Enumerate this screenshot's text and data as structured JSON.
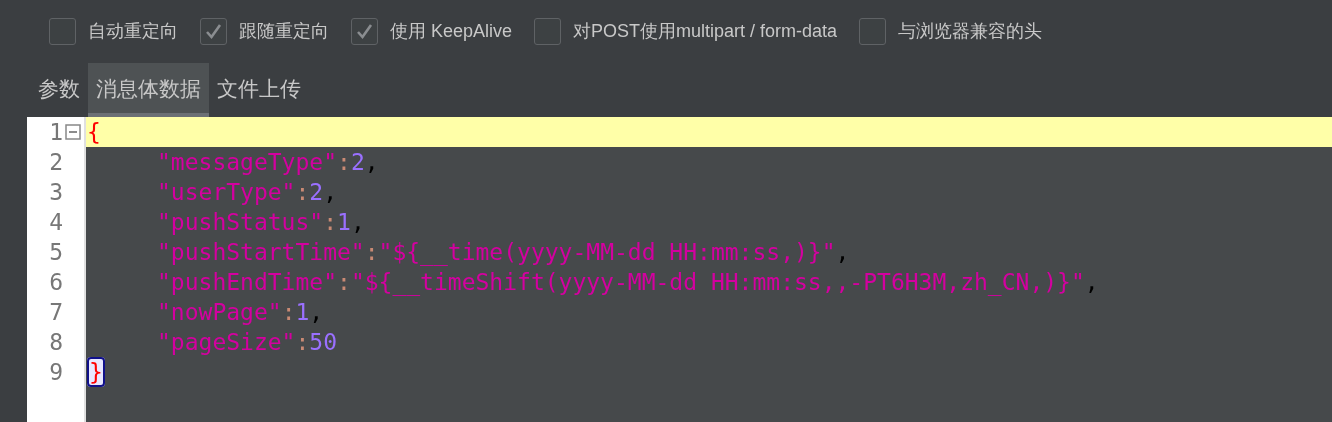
{
  "options": [
    {
      "label": "自动重定向",
      "checked": false
    },
    {
      "label": "跟随重定向",
      "checked": true
    },
    {
      "label": "使用 KeepAlive",
      "checked": true
    },
    {
      "label": "对POST使用multipart / form-data",
      "checked": false
    },
    {
      "label": "与浏览器兼容的头",
      "checked": false
    }
  ],
  "tabs": [
    {
      "label": "参数",
      "selected": false
    },
    {
      "label": "消息体数据",
      "selected": true
    },
    {
      "label": "文件上传",
      "selected": false
    }
  ],
  "editor": {
    "lines": [
      {
        "number": "1",
        "current": true,
        "foldable": true,
        "indented": false,
        "tokens": [
          {
            "kind": "brace",
            "text": "{"
          }
        ]
      },
      {
        "number": "2",
        "current": false,
        "foldable": false,
        "indented": true,
        "tokens": [
          {
            "kind": "key",
            "text": "\"messageType\""
          },
          {
            "kind": "colon",
            "text": ":"
          },
          {
            "kind": "number",
            "text": "2"
          },
          {
            "kind": "comma",
            "text": ","
          }
        ]
      },
      {
        "number": "3",
        "current": false,
        "foldable": false,
        "indented": true,
        "tokens": [
          {
            "kind": "key",
            "text": "\"userType\""
          },
          {
            "kind": "colon",
            "text": ":"
          },
          {
            "kind": "number",
            "text": "2"
          },
          {
            "kind": "comma",
            "text": ","
          }
        ]
      },
      {
        "number": "4",
        "current": false,
        "foldable": false,
        "indented": true,
        "tokens": [
          {
            "kind": "key",
            "text": "\"pushStatus\""
          },
          {
            "kind": "colon",
            "text": ":"
          },
          {
            "kind": "number",
            "text": "1"
          },
          {
            "kind": "comma",
            "text": ","
          }
        ]
      },
      {
        "number": "5",
        "current": false,
        "foldable": false,
        "indented": true,
        "tokens": [
          {
            "kind": "key",
            "text": "\"pushStartTime\""
          },
          {
            "kind": "colon",
            "text": ":"
          },
          {
            "kind": "string",
            "text": "\"${__time(yyyy-MM-dd HH:mm:ss,)}\""
          },
          {
            "kind": "comma",
            "text": ","
          }
        ]
      },
      {
        "number": "6",
        "current": false,
        "foldable": false,
        "indented": true,
        "tokens": [
          {
            "kind": "key",
            "text": "\"pushEndTime\""
          },
          {
            "kind": "colon",
            "text": ":"
          },
          {
            "kind": "string",
            "text": "\"${__timeShift(yyyy-MM-dd HH:mm:ss,,-PT6H3M,zh_CN,)}\""
          },
          {
            "kind": "comma",
            "text": ","
          }
        ]
      },
      {
        "number": "7",
        "current": false,
        "foldable": false,
        "indented": true,
        "tokens": [
          {
            "kind": "key",
            "text": "\"nowPage\""
          },
          {
            "kind": "colon",
            "text": ":"
          },
          {
            "kind": "number",
            "text": "1"
          },
          {
            "kind": "comma",
            "text": ","
          }
        ]
      },
      {
        "number": "8",
        "current": false,
        "foldable": false,
        "indented": true,
        "tokens": [
          {
            "kind": "key",
            "text": "\"pageSize\""
          },
          {
            "kind": "colon",
            "text": ":"
          },
          {
            "kind": "number",
            "text": "50"
          }
        ]
      },
      {
        "number": "9",
        "current": false,
        "foldable": false,
        "indented": false,
        "tokens": [
          {
            "kind": "brace_matched",
            "text": "}"
          }
        ]
      }
    ]
  }
}
